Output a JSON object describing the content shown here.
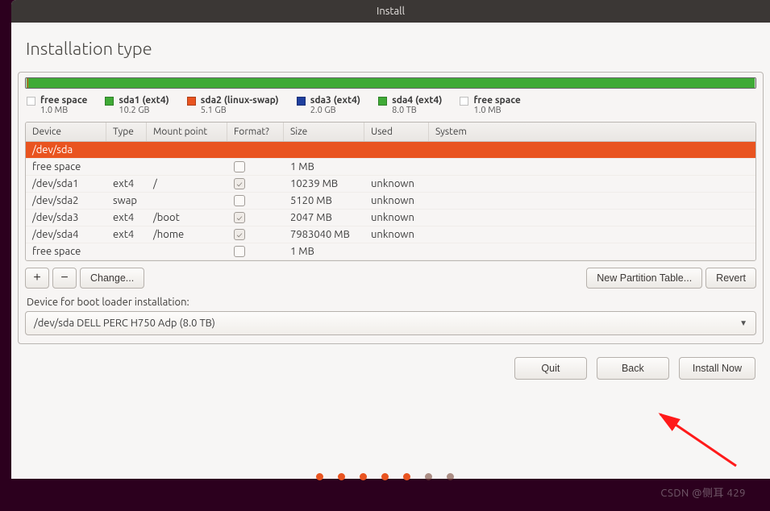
{
  "window": {
    "title": "Install"
  },
  "page": {
    "heading": "Installation type"
  },
  "legend": [
    {
      "name": "free space",
      "size": "1.0 MB",
      "color": ""
    },
    {
      "name": "sda1 (ext4)",
      "size": "10.2 GB",
      "color": "#3faa36"
    },
    {
      "name": "sda2 (linux-swap)",
      "size": "5.1 GB",
      "color": "#e95420"
    },
    {
      "name": "sda3 (ext4)",
      "size": "2.0 GB",
      "color": "#1f3f9e"
    },
    {
      "name": "sda4 (ext4)",
      "size": "8.0 TB",
      "color": "#3faa36"
    },
    {
      "name": "free space",
      "size": "1.0 MB",
      "color": ""
    }
  ],
  "columns": {
    "device": "Device",
    "type": "Type",
    "mount": "Mount point",
    "format": "Format?",
    "size": "Size",
    "used": "Used",
    "system": "System"
  },
  "rows": [
    {
      "device": "/dev/sda",
      "type": "",
      "mount": "",
      "format": null,
      "size": "",
      "used": "",
      "selected": true
    },
    {
      "device": "free space",
      "type": "",
      "mount": "",
      "format": false,
      "size": "1 MB",
      "used": "",
      "selected": false
    },
    {
      "device": "/dev/sda1",
      "type": "ext4",
      "mount": "/",
      "format": true,
      "size": "10239 MB",
      "used": "unknown",
      "selected": false
    },
    {
      "device": "/dev/sda2",
      "type": "swap",
      "mount": "",
      "format": false,
      "size": "5120 MB",
      "used": "unknown",
      "selected": false
    },
    {
      "device": "/dev/sda3",
      "type": "ext4",
      "mount": "/boot",
      "format": true,
      "size": "2047 MB",
      "used": "unknown",
      "selected": false
    },
    {
      "device": "/dev/sda4",
      "type": "ext4",
      "mount": "/home",
      "format": true,
      "size": "7983040 MB",
      "used": "unknown",
      "selected": false
    },
    {
      "device": "free space",
      "type": "",
      "mount": "",
      "format": false,
      "size": "1 MB",
      "used": "",
      "selected": false
    }
  ],
  "toolbar": {
    "add": "+",
    "remove": "−",
    "change": "Change...",
    "newtable": "New Partition Table...",
    "revert": "Revert"
  },
  "bootloader": {
    "label": "Device for boot loader installation:",
    "value": "/dev/sda   DELL PERC H750 Adp (8.0 TB)"
  },
  "footer": {
    "quit": "Quit",
    "back": "Back",
    "install": "Install Now"
  },
  "watermark": "CSDN @侧耳 429"
}
